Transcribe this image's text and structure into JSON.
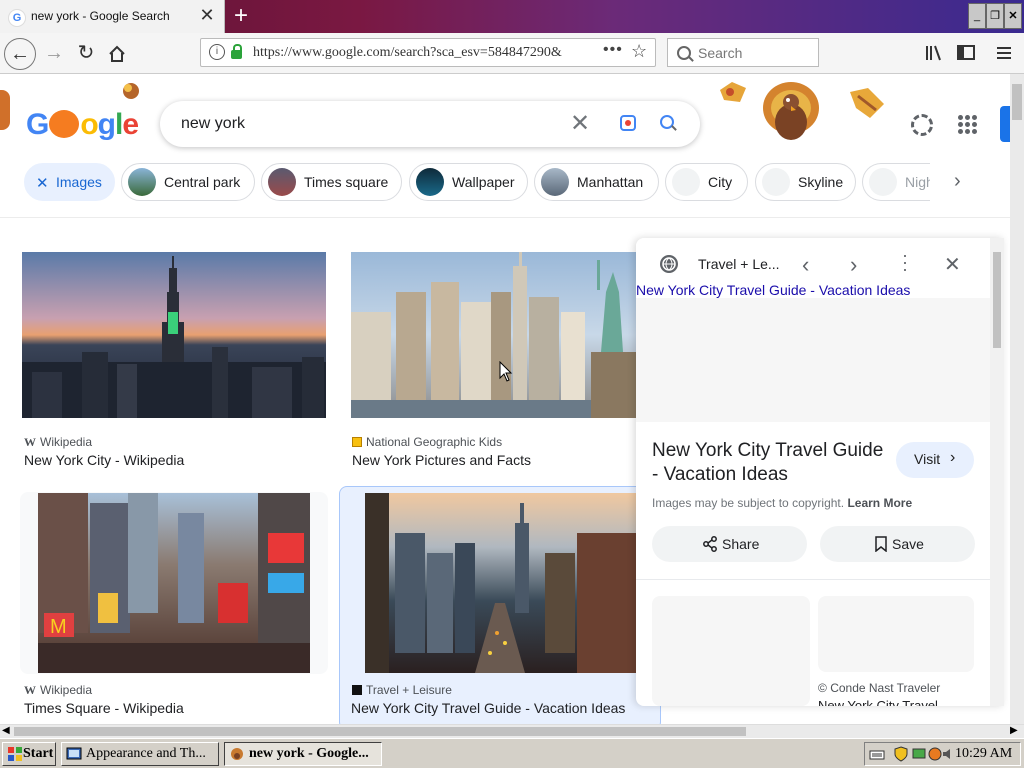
{
  "browser": {
    "tab_title": "new york - Google Search",
    "tab_favicon": "G",
    "new_tab_label": "+",
    "url": "https://www.google.com/search?sca_esv=584847290&",
    "search_placeholder": "Search",
    "window_controls": {
      "minimize": "_",
      "restore": "❐",
      "close": "✕"
    }
  },
  "google": {
    "query": "new york",
    "chips": [
      {
        "label": "Images",
        "selected": true
      },
      {
        "label": "Central park"
      },
      {
        "label": "Times square"
      },
      {
        "label": "Wallpaper"
      },
      {
        "label": "Manhattan"
      },
      {
        "label": "City"
      },
      {
        "label": "Skyline"
      },
      {
        "label": "Night"
      }
    ]
  },
  "results": [
    {
      "source": "Wikipedia",
      "caption": "New York City - Wikipedia"
    },
    {
      "source": "National Geographic Kids",
      "caption": "New York Pictures and Facts"
    },
    {
      "source": "Wikipedia",
      "caption": "Times Square - Wikipedia"
    },
    {
      "source": "Travel + Leisure",
      "caption": "New York City Travel Guide - Vacation Ideas"
    }
  ],
  "panel": {
    "site": "Travel + Le...",
    "top_link": "New York City Travel Guide - Vacation Ideas",
    "title": "New York City Travel Guide - Vacation Ideas",
    "visit_label": "Visit",
    "copyright": "Images may be subject to copyright.",
    "learn_more": "Learn More",
    "share_label": "Share",
    "save_label": "Save",
    "related_source": "Conde Nast Traveler",
    "related_caption": "New York City Travel"
  },
  "taskbar": {
    "start_label": "Start",
    "tasks": [
      {
        "label": "Appearance and Th..."
      },
      {
        "label": "new york - Google..."
      }
    ],
    "clock": "10:29 AM"
  },
  "colors": {
    "google_blue": "#1a73e8",
    "chip_selected_bg": "#e8f0fe",
    "visit_bg": "#e8f0fe"
  }
}
